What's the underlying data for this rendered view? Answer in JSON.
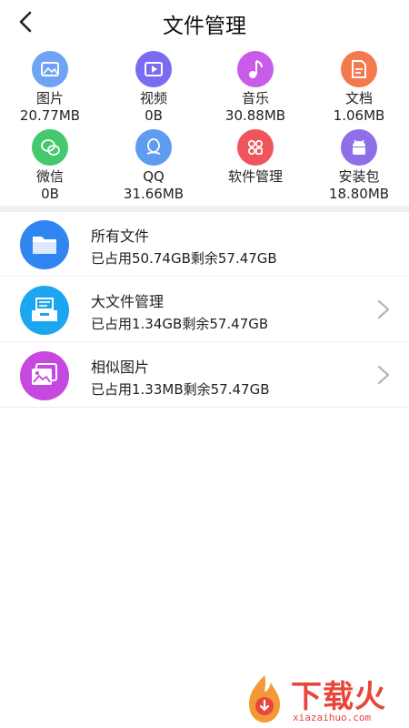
{
  "header": {
    "title": "文件管理",
    "back_icon": "chevron-left-icon"
  },
  "categories": [
    {
      "label": "图片",
      "size": "20.77MB",
      "icon": "image-icon",
      "color": "#6FA3F4"
    },
    {
      "label": "视频",
      "size": "0B",
      "icon": "video-icon",
      "color": "#7A6CF0"
    },
    {
      "label": "音乐",
      "size": "30.88MB",
      "icon": "music-note-icon",
      "color": "#C95BEA"
    },
    {
      "label": "文档",
      "size": "1.06MB",
      "icon": "document-icon",
      "color": "#F27A4E"
    },
    {
      "label": "微信",
      "size": "0B",
      "icon": "wechat-icon",
      "color": "#45C96E"
    },
    {
      "label": "QQ",
      "size": "31.66MB",
      "icon": "qq-icon",
      "color": "#5E9CF1"
    },
    {
      "label": "软件管理",
      "size": "",
      "icon": "apps-icon",
      "color": "#F0545C"
    },
    {
      "label": "安装包",
      "size": "18.80MB",
      "icon": "android-icon",
      "color": "#8E6FE8"
    }
  ],
  "list": [
    {
      "title": "所有文件",
      "subtitle": "已占用50.74GB剩余57.47GB",
      "icon": "folder-icon",
      "color": "#2F86F1",
      "has_chevron": false
    },
    {
      "title": "大文件管理",
      "subtitle": "已占用1.34GB剩余57.47GB",
      "icon": "archive-box-icon",
      "color": "#1DA6F0",
      "has_chevron": true
    },
    {
      "title": "相似图片",
      "subtitle": "已占用1.33MB剩余57.47GB",
      "icon": "photos-icon",
      "color": "#C748E0",
      "has_chevron": true
    }
  ],
  "watermark": {
    "brand": "下载火",
    "url": "xiazaihuo.com",
    "color": "#E8463B"
  }
}
